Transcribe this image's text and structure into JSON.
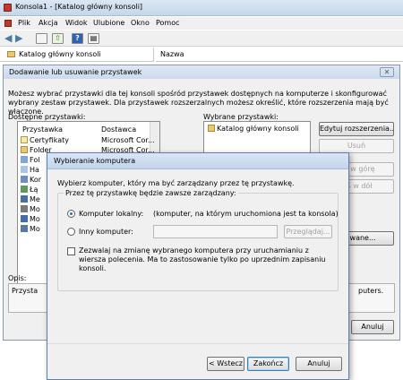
{
  "window": {
    "title": "Konsola1 - [Katalog główny konsoli]"
  },
  "menu": [
    "Plik",
    "Akcja",
    "Widok",
    "Ulubione",
    "Okno",
    "Pomoc"
  ],
  "main_panel": {
    "tree_root": "Katalog główny konsoli",
    "column_name": "Nazwa"
  },
  "snapin_dialog": {
    "title": "Dodawanie lub usuwanie przystawek",
    "description": "Możesz wybrać przystawki dla tej konsoli spośród przystawek dostępnych na komputerze i skonfigurować wybrany zestaw przystawek. Dla przystawek rozszerzalnych możesz określić, które rozszerzenia mają być włączone.",
    "available_label": "Dostępne przystawki:",
    "col_snapin": "Przystawka",
    "col_vendor": "Dostawca",
    "available_items": [
      {
        "name": "Certyfikaty",
        "vendor": "Microsoft Cor..."
      },
      {
        "name": "Folder",
        "vendor": "Microsoft Cor..."
      },
      {
        "name": "Fol",
        "vendor": ""
      },
      {
        "name": "Ha",
        "vendor": ""
      },
      {
        "name": "Kor",
        "vendor": ""
      },
      {
        "name": "Łą",
        "vendor": ""
      },
      {
        "name": "Me",
        "vendor": ""
      },
      {
        "name": "Mo",
        "vendor": ""
      },
      {
        "name": "Mo",
        "vendor": ""
      },
      {
        "name": "Mo",
        "vendor": ""
      }
    ],
    "selected_label": "Wybrane przystawki:",
    "selected_items": [
      "Katalog główny konsoli"
    ],
    "edit_extensions": "Edytuj rozszerzenia...",
    "remove": "Usuń",
    "move_up": "ięś w górę",
    "move_down": "ieś w dół",
    "advanced": "nsowane...",
    "desc_label": "Opis:",
    "desc_left": "Przysta",
    "desc_right": "puters.",
    "cancel": "Anuluj"
  },
  "computer_dialog": {
    "title": "Wybieranie komputera",
    "intro": "Wybierz komputer, który ma być zarządzany przez tę przystawkę.",
    "group_label": "Przez tę przystawkę będzie zawsze zarządzany:",
    "local_option": "Komputer lokalny:",
    "local_note": "(komputer, na którym uruchomiona jest ta konsola)",
    "other_option": "Inny komputer:",
    "other_value": "",
    "browse": "Przeglądaj...",
    "allow_change": "Zezwalaj na zmianę wybranego komputera przy uruchamianiu z wiersza polecenia. Ma to zastosowanie tylko po uprzednim zapisaniu konsoli.",
    "back": "< Wstecz",
    "finish": "Zakończ",
    "cancel": "Anuluj"
  },
  "icons": [
    "console-icon",
    "back-icon",
    "forward-icon",
    "close-icon",
    "help-icon",
    "folder-icon",
    "certificate-icon"
  ]
}
